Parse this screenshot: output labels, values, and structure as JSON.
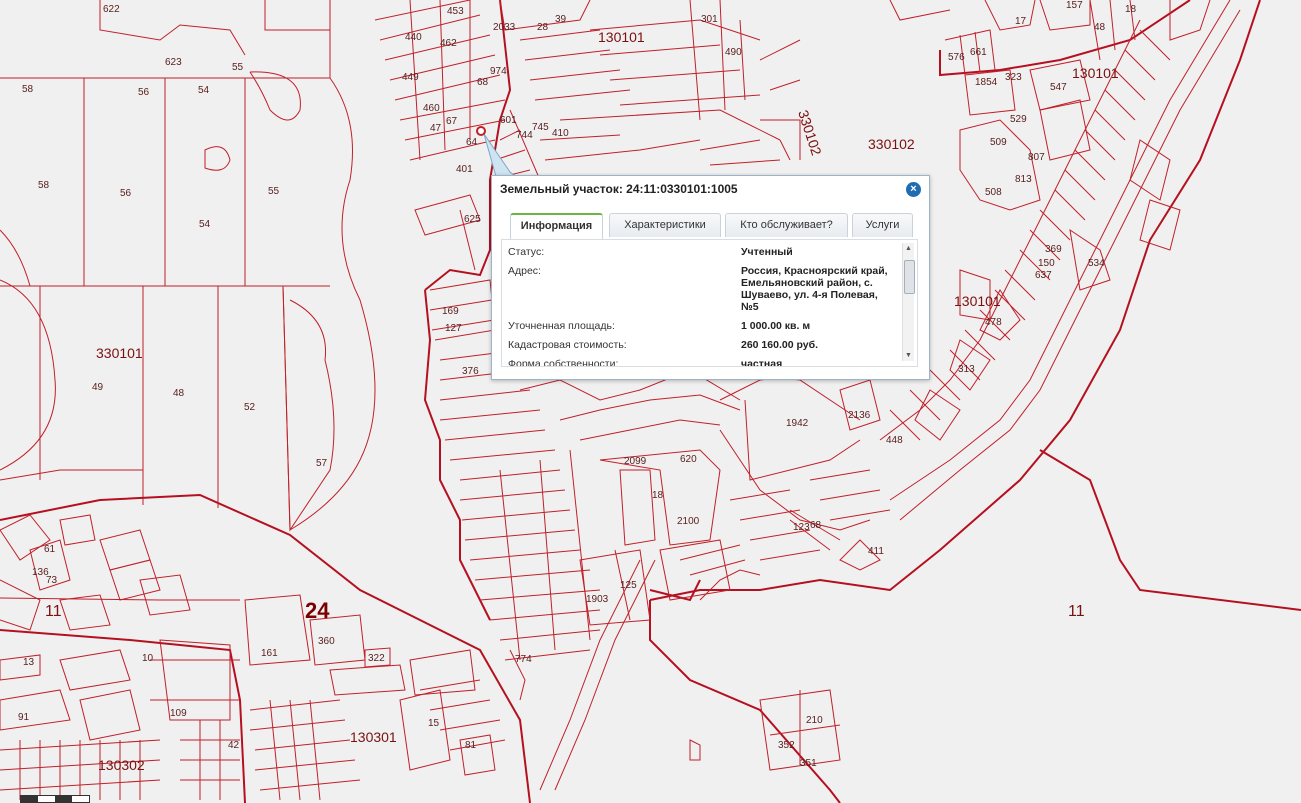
{
  "popup": {
    "title": "Земельный участок: 24:11:0330101:1005",
    "close_symbol": "×",
    "tabs": [
      "Информация",
      "Характеристики",
      "Кто обслуживает?",
      "Услуги"
    ],
    "rows": [
      {
        "label": "Статус:",
        "value": "Учтенный"
      },
      {
        "label": "Адрес:",
        "value": "Россия, Красноярский край, Емельяновский район, с. Шуваево, ул. 4-я Полевая, №5"
      },
      {
        "label": "Уточненная площадь:",
        "value": "1 000.00 кв. м"
      },
      {
        "label": "Кадастровая стоимость:",
        "value": "260 160.00 руб."
      },
      {
        "label": "Форма собственности:",
        "value": "частная"
      }
    ]
  },
  "map": {
    "colors": {
      "parcel": "#c0202a",
      "background": "#f0f0f0",
      "popup_border": "#9db3c8",
      "tab_active": "#6eb346"
    },
    "district_labels": {
      "big": "24",
      "left": "11",
      "right": "11"
    },
    "quarter_labels": [
      "330101",
      "130101",
      "130101",
      "330102",
      "330102",
      "130101",
      "130301",
      "130302"
    ],
    "parcel_labels": [
      "622",
      "623",
      "55",
      "58",
      "56",
      "54",
      "58",
      "56",
      "54",
      "55",
      "49",
      "48",
      "52",
      "57",
      "453",
      "462",
      "440",
      "449",
      "460",
      "47",
      "67",
      "68",
      "974",
      "2033",
      "28",
      "39",
      "301",
      "490",
      "601",
      "744",
      "745",
      "410",
      "64",
      "401",
      "625",
      "17",
      "157",
      "48",
      "18",
      "576",
      "661",
      "1854",
      "323",
      "547",
      "529",
      "509",
      "807",
      "813",
      "508",
      "369",
      "150",
      "637",
      "534",
      "478",
      "313",
      "169",
      "127",
      "376",
      "1942",
      "2136",
      "448",
      "2099",
      "18",
      "620",
      "2100",
      "123",
      "68",
      "411",
      "1903",
      "125",
      "774",
      "161",
      "360",
      "322",
      "13",
      "10",
      "91",
      "109",
      "42",
      "15",
      "81",
      "352",
      "210",
      "351",
      "136",
      "61",
      "73"
    ]
  }
}
